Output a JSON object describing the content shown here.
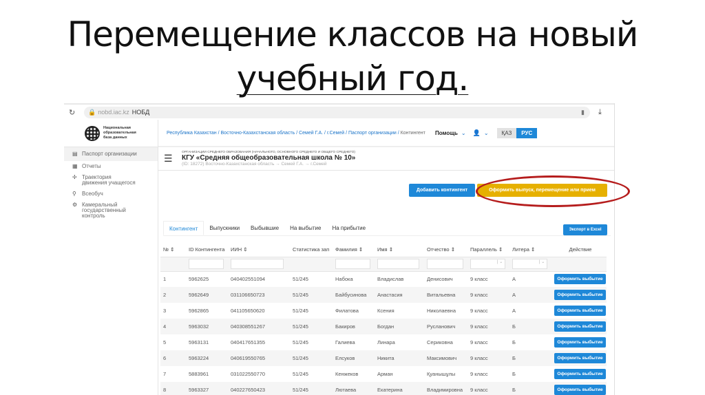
{
  "slide_title": {
    "line1": "Перемещение классов на новый",
    "line2": "учебный год."
  },
  "browser": {
    "domain": "nobd.iac.kz",
    "page_title": "НОБД"
  },
  "logo": {
    "text": "Национальная образовательная база данных"
  },
  "sidebar": {
    "items": [
      {
        "label": "Паспорт организации",
        "icon": "id-card-icon"
      },
      {
        "label": "Отчеты",
        "icon": "document-icon"
      },
      {
        "label": "Траектория движения учащегося",
        "icon": "signpost-icon"
      },
      {
        "label": "Всеобуч",
        "icon": "bell-icon"
      },
      {
        "label": "Камеральный государственный контроль",
        "icon": "inspection-icon"
      }
    ]
  },
  "breadcrumb": [
    "Республика Казахстан",
    "Восточно-Казахстанская область",
    "Семей Г.А.",
    "г.Семей",
    "Паспорт организации",
    "Контингент"
  ],
  "header": {
    "help": "Помощь",
    "lang_kz": "ҚАЗ",
    "lang_ru": "РУС"
  },
  "org": {
    "type": "ОРГАНИЗАЦИИ СРЕДНЕГО ОБРАЗОВАНИЯ (НАЧАЛЬНОГО, ОСНОВНОГО СРЕДНЕГО И ОБЩЕГО СРЕДНЕГО)",
    "name": "КГУ «Средняя общеобразовательная школа № 10»",
    "sub": "(ID: 18272)   Восточно-Казахстанская область → Семей Г.А. → г.Семей"
  },
  "buttons": {
    "add": "Добавить контингент",
    "transfer": "Оформить выпуск, перемещение или прием",
    "export": "Экспорт в Excel",
    "row_action": "Оформить выбытие"
  },
  "tabs": [
    "Контингент",
    "Выпускники",
    "Выбывшие",
    "На выбытие",
    "На прибытие"
  ],
  "table": {
    "headers": [
      "№ ⇕",
      "ID Контингента",
      "ИИН ⇕",
      "Статистика зап",
      "Фамилия ⇕",
      "Имя ⇕",
      "Отчество ⇕",
      "Параллель ⇕",
      "Литера ⇕",
      "Действие"
    ],
    "rows": [
      [
        "1",
        "5962625",
        "040402551094",
        "51/245",
        "Набока",
        "Владислав",
        "Денисович",
        "9 класс",
        "А"
      ],
      [
        "2",
        "5962649",
        "031106650723",
        "51/245",
        "Байбусинова",
        "Анастасия",
        "Витальевна",
        "9 класс",
        "А"
      ],
      [
        "3",
        "5962865",
        "041105650620",
        "51/245",
        "Филатова",
        "Ксения",
        "Николаевна",
        "9 класс",
        "А"
      ],
      [
        "4",
        "5963032",
        "040308551267",
        "51/245",
        "Бакиров",
        "Богдан",
        "Русланович",
        "9 класс",
        "Б"
      ],
      [
        "5",
        "5963131",
        "040417651355",
        "51/245",
        "Галиева",
        "Линара",
        "Сериковна",
        "9 класс",
        "Б"
      ],
      [
        "6",
        "5963224",
        "040619550765",
        "51/245",
        "Елсуков",
        "Никита",
        "Максимович",
        "9 класс",
        "Б"
      ],
      [
        "7",
        "5883961",
        "031022550770",
        "51/245",
        "Кенжеков",
        "Арман",
        "Қуанышұлы",
        "9 класс",
        "Б"
      ],
      [
        "8",
        "5963327",
        "040227650423",
        "51/245",
        "Лютаева",
        "Екатерина",
        "Владимировна",
        "9 класс",
        "Б"
      ]
    ]
  }
}
